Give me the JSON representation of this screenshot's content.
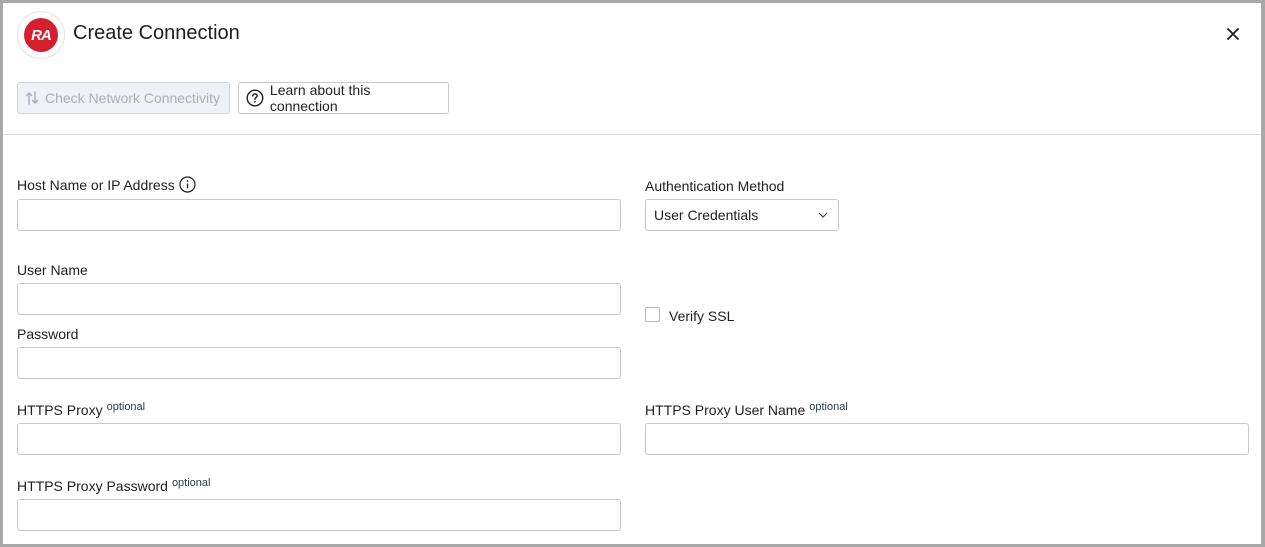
{
  "dialog": {
    "title": "Create Connection",
    "logo_text": "RA",
    "close_icon": "close-icon"
  },
  "toolbar": {
    "check_network_label": "Check Network Connectivity",
    "check_network_disabled": true,
    "learn_label": "Learn about this connection"
  },
  "form": {
    "host": {
      "label": "Host Name or IP Address",
      "value": "",
      "has_info_icon": true
    },
    "auth_method": {
      "label": "Authentication Method",
      "value": "User Credentials"
    },
    "user_name": {
      "label": "User Name",
      "value": ""
    },
    "password": {
      "label": "Password",
      "value": ""
    },
    "verify_ssl": {
      "label": "Verify SSL",
      "checked": false
    },
    "https_proxy": {
      "label": "HTTPS Proxy",
      "tag": "optional",
      "value": ""
    },
    "https_proxy_user": {
      "label": "HTTPS Proxy User Name",
      "tag": "optional",
      "value": ""
    },
    "https_proxy_password": {
      "label": "HTTPS Proxy Password",
      "tag": "optional",
      "value": ""
    }
  },
  "colors": {
    "brand": "#d51f2f",
    "border": "#c8c8c8",
    "disabled_bg": "#eef1f5",
    "disabled_text": "#a9b0ba",
    "optional_text": "#2b3a55"
  }
}
